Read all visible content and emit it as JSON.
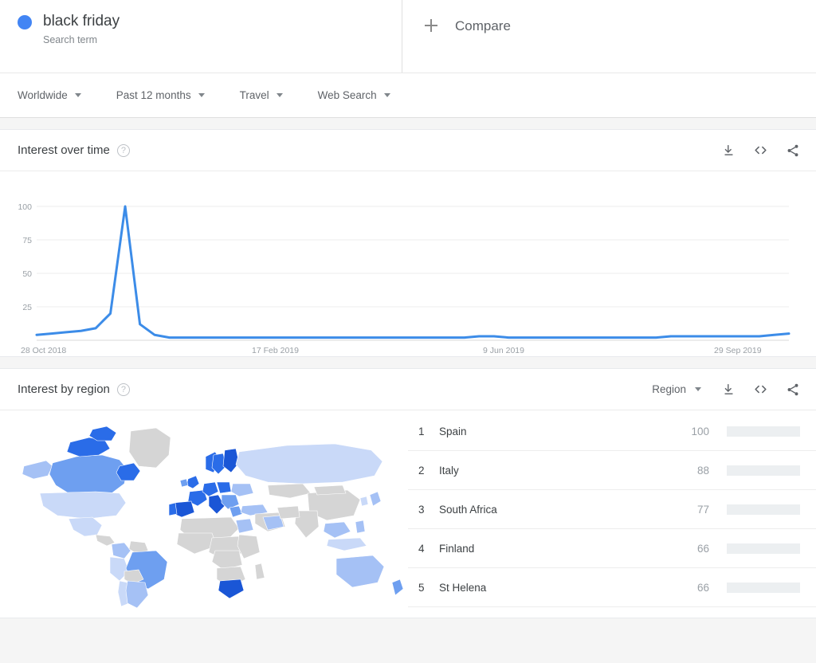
{
  "term": {
    "title": "black friday",
    "subtitle": "Search term",
    "dot_color": "#4285f4"
  },
  "compare": {
    "label": "Compare",
    "icon": "plus-icon"
  },
  "filters": [
    {
      "label": "Worldwide"
    },
    {
      "label": "Past 12 months"
    },
    {
      "label": "Travel"
    },
    {
      "label": "Web Search"
    }
  ],
  "interest_over_time": {
    "title": "Interest over time",
    "help_icon": "help-circle-icon",
    "actions": [
      {
        "name": "download-icon"
      },
      {
        "name": "embed-icon"
      },
      {
        "name": "share-icon"
      }
    ]
  },
  "interest_by_region": {
    "title": "Interest by region",
    "help_icon": "help-circle-icon",
    "region_select": "Region",
    "actions": [
      {
        "name": "download-icon"
      },
      {
        "name": "embed-icon"
      },
      {
        "name": "share-icon"
      }
    ],
    "rows": [
      {
        "rank": "1",
        "name": "Spain",
        "value": "100",
        "pct": 100
      },
      {
        "rank": "2",
        "name": "Italy",
        "value": "88",
        "pct": 88
      },
      {
        "rank": "3",
        "name": "South Africa",
        "value": "77",
        "pct": 77
      },
      {
        "rank": "4",
        "name": "Finland",
        "value": "66",
        "pct": 66
      },
      {
        "rank": "5",
        "name": "St Helena",
        "value": "66",
        "pct": 66
      }
    ]
  },
  "chart_data": {
    "type": "line",
    "title": "Interest over time",
    "xlabel": "",
    "ylabel": "",
    "ylim": [
      0,
      100
    ],
    "yticks": [
      25,
      50,
      75,
      100
    ],
    "grid": true,
    "legend": false,
    "line_color": "#3c8ce8",
    "xtick_labels": [
      "28 Oct 2018",
      "17 Feb 2019",
      "9 Jun 2019",
      "29 Sep 2019"
    ],
    "xtick_positions": [
      0,
      16,
      32,
      48
    ],
    "series": [
      {
        "name": "black friday",
        "x": [
          0,
          1,
          2,
          3,
          4,
          5,
          6,
          7,
          8,
          9,
          10,
          11,
          12,
          13,
          14,
          15,
          16,
          17,
          18,
          19,
          20,
          21,
          22,
          23,
          24,
          25,
          26,
          27,
          28,
          29,
          30,
          31,
          32,
          33,
          34,
          35,
          36,
          37,
          38,
          39,
          40,
          41,
          42,
          43,
          44,
          45,
          46,
          47,
          48,
          49,
          50,
          51
        ],
        "values": [
          4,
          5,
          6,
          7,
          9,
          20,
          100,
          12,
          4,
          2,
          2,
          2,
          2,
          2,
          2,
          2,
          2,
          2,
          2,
          2,
          2,
          2,
          2,
          2,
          2,
          2,
          2,
          2,
          2,
          2,
          3,
          3,
          2,
          2,
          2,
          2,
          2,
          2,
          2,
          2,
          2,
          2,
          2,
          3,
          3,
          3,
          3,
          3,
          3,
          3,
          4,
          5
        ]
      }
    ]
  },
  "map": {
    "name": "world-choropleth-map",
    "no_data_color": "#d5d5d5",
    "scale_colors": [
      "#c9d9f8",
      "#a5c1f5",
      "#6e9ff0",
      "#2a6ce8",
      "#1a56d6"
    ]
  }
}
